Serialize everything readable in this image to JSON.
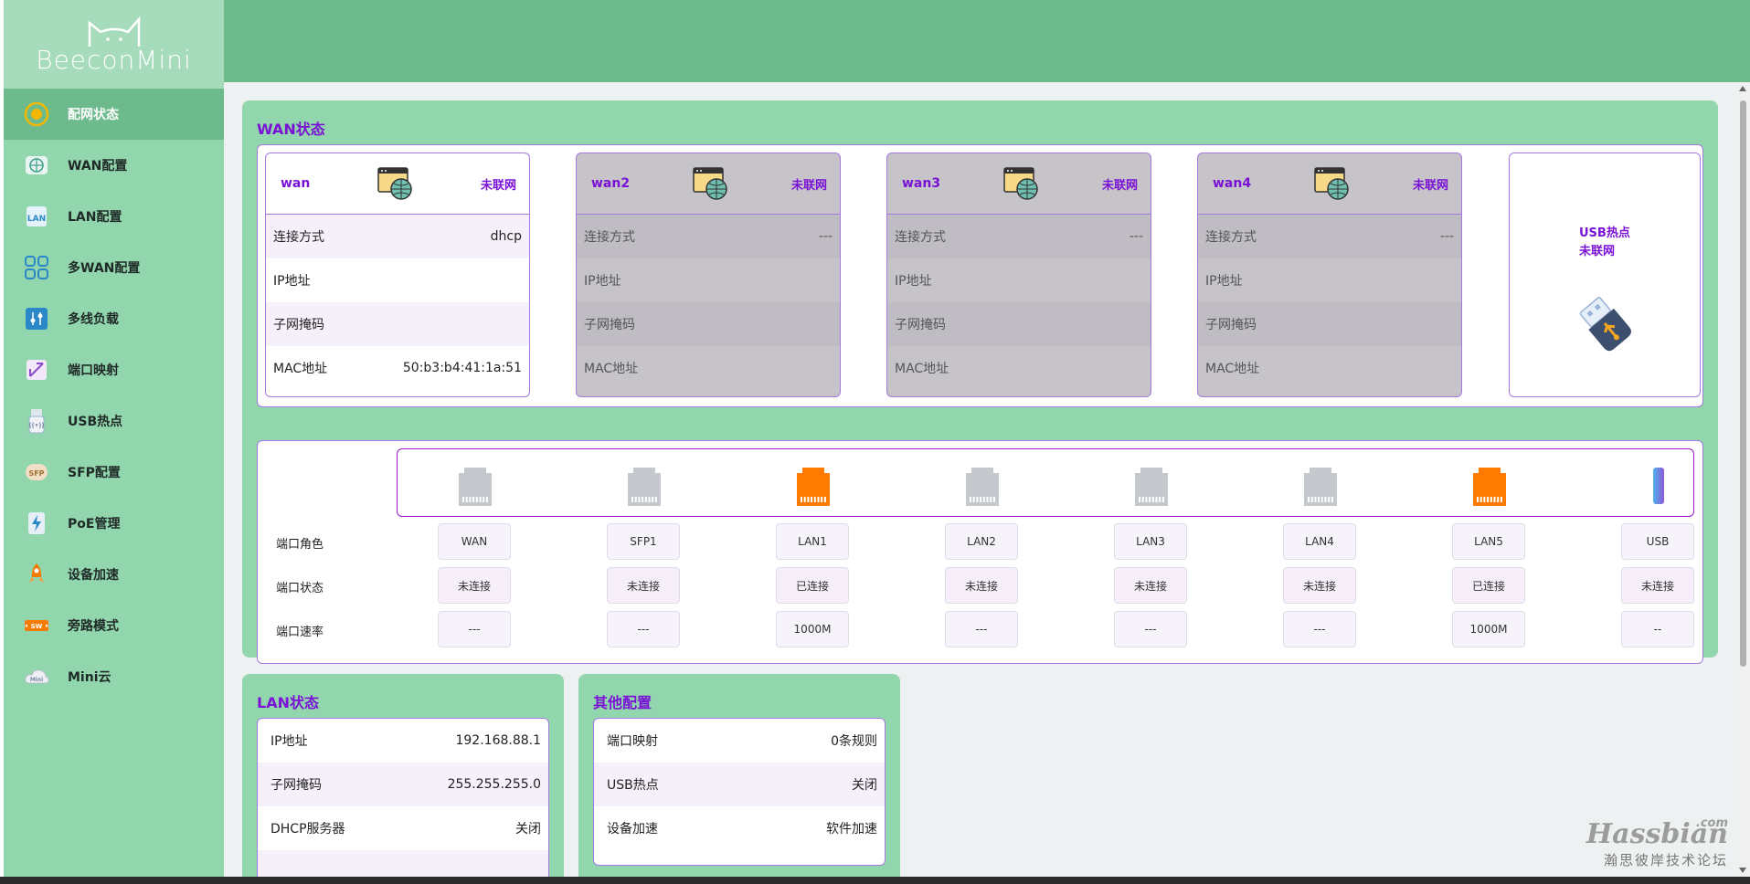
{
  "brand": "BeeconMini",
  "sidebar": {
    "items": [
      {
        "label": "配网状态",
        "icon": "network-status-icon",
        "active": true
      },
      {
        "label": "WAN配置",
        "icon": "globe-icon"
      },
      {
        "label": "LAN配置",
        "icon": "lan-icon"
      },
      {
        "label": "多WAN配置",
        "icon": "multi-wan-icon"
      },
      {
        "label": "多线负载",
        "icon": "load-balance-icon"
      },
      {
        "label": "端口映射",
        "icon": "port-mapping-icon"
      },
      {
        "label": "USB热点",
        "icon": "usb-hotspot-icon"
      },
      {
        "label": "SFP配置",
        "icon": "sfp-icon"
      },
      {
        "label": "PoE管理",
        "icon": "poe-icon"
      },
      {
        "label": "设备加速",
        "icon": "rocket-icon"
      },
      {
        "label": "旁路模式",
        "icon": "bypass-icon"
      },
      {
        "label": "Mini云",
        "icon": "cloud-icon"
      }
    ]
  },
  "wan_section": {
    "title": "WAN状态",
    "panels": [
      {
        "name": "wan",
        "status": "未联网",
        "dim": false,
        "rows": [
          {
            "label": "连接方式",
            "value": "dhcp"
          },
          {
            "label": "IP地址",
            "value": ""
          },
          {
            "label": "子网掩码",
            "value": ""
          },
          {
            "label": "MAC地址",
            "value": "50:b3:b4:41:1a:51"
          }
        ]
      },
      {
        "name": "wan2",
        "status": "未联网",
        "dim": true,
        "rows": [
          {
            "label": "连接方式",
            "value": "---"
          },
          {
            "label": "IP地址",
            "value": ""
          },
          {
            "label": "子网掩码",
            "value": ""
          },
          {
            "label": "MAC地址",
            "value": ""
          }
        ]
      },
      {
        "name": "wan3",
        "status": "未联网",
        "dim": true,
        "rows": [
          {
            "label": "连接方式",
            "value": "---"
          },
          {
            "label": "IP地址",
            "value": ""
          },
          {
            "label": "子网掩码",
            "value": ""
          },
          {
            "label": "MAC地址",
            "value": ""
          }
        ]
      },
      {
        "name": "wan4",
        "status": "未联网",
        "dim": true,
        "rows": [
          {
            "label": "连接方式",
            "value": "---"
          },
          {
            "label": "IP地址",
            "value": ""
          },
          {
            "label": "子网掩码",
            "value": ""
          },
          {
            "label": "MAC地址",
            "value": ""
          }
        ]
      }
    ],
    "usb": {
      "title": "USB热点",
      "status": "未联网"
    }
  },
  "ports": {
    "row_labels": {
      "role": "端口角色",
      "status": "端口状态",
      "speed": "端口速率"
    },
    "items": [
      {
        "role": "WAN",
        "status": "未连接",
        "speed": "---",
        "color": "#c5c8cc"
      },
      {
        "role": "SFP1",
        "status": "未连接",
        "speed": "---",
        "color": "#c5c8cc"
      },
      {
        "role": "LAN1",
        "status": "已连接",
        "speed": "1000M",
        "color": "#ff7a00"
      },
      {
        "role": "LAN2",
        "status": "未连接",
        "speed": "---",
        "color": "#c5c8cc"
      },
      {
        "role": "LAN3",
        "status": "未连接",
        "speed": "---",
        "color": "#c5c8cc"
      },
      {
        "role": "LAN4",
        "status": "未连接",
        "speed": "---",
        "color": "#c5c8cc"
      },
      {
        "role": "LAN5",
        "status": "已连接",
        "speed": "1000M",
        "color": "#ff7a00"
      },
      {
        "role": "USB",
        "status": "未连接",
        "speed": "--",
        "color": "usb"
      }
    ]
  },
  "lan_section": {
    "title": "LAN状态",
    "rows": [
      {
        "label": "IP地址",
        "value": "192.168.88.1"
      },
      {
        "label": "子网掩码",
        "value": "255.255.255.0"
      },
      {
        "label": "DHCP服务器",
        "value": "关闭"
      },
      {
        "label": "",
        "value": ""
      }
    ]
  },
  "other_section": {
    "title": "其他配置",
    "rows": [
      {
        "label": "端口映射",
        "value": "0条规则"
      },
      {
        "label": "USB热点",
        "value": "关闭"
      },
      {
        "label": "设备加速",
        "value": "软件加速"
      }
    ]
  },
  "watermark": {
    "main": "Hassbian",
    "sub": "瀚思彼岸技术论坛",
    "tld": ".com"
  },
  "colors": {
    "accent": "#7a12d6",
    "sidebar": "#92d6ad",
    "header": "#6dbb8d",
    "active_port": "#ff7a00"
  }
}
